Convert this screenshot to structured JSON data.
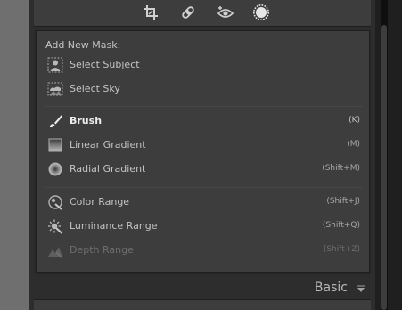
{
  "toolbar": {
    "tools": [
      {
        "icon": "crop-icon"
      },
      {
        "icon": "healing-icon"
      },
      {
        "icon": "red-eye-icon"
      },
      {
        "icon": "masking-icon"
      }
    ]
  },
  "mask_menu": {
    "header": "Add New Mask:",
    "items": [
      {
        "label": "Select Subject",
        "shortcut": "",
        "icon": "subject-icon"
      },
      {
        "label": "Select Sky",
        "shortcut": "",
        "icon": "sky-icon"
      },
      {
        "label": "Brush",
        "shortcut": "(K)",
        "icon": "brush-icon"
      },
      {
        "label": "Linear Gradient",
        "shortcut": "(M)",
        "icon": "linear-gradient-icon"
      },
      {
        "label": "Radial Gradient",
        "shortcut": "(Shift+M)",
        "icon": "radial-gradient-icon"
      },
      {
        "label": "Color Range",
        "shortcut": "(Shift+J)",
        "icon": "color-range-icon"
      },
      {
        "label": "Luminance Range",
        "shortcut": "(Shift+Q)",
        "icon": "luminance-range-icon"
      },
      {
        "label": "Depth Range",
        "shortcut": "(Shift+Z)",
        "icon": "depth-range-icon"
      }
    ]
  },
  "panel": {
    "title": "Basic"
  },
  "colors": {
    "panel_bg": "#3d3d3d",
    "frame_bg": "#2d2d2d",
    "text": "#c4c4c4",
    "text_highlight": "#ececec",
    "text_disabled": "#6e6e6e"
  }
}
